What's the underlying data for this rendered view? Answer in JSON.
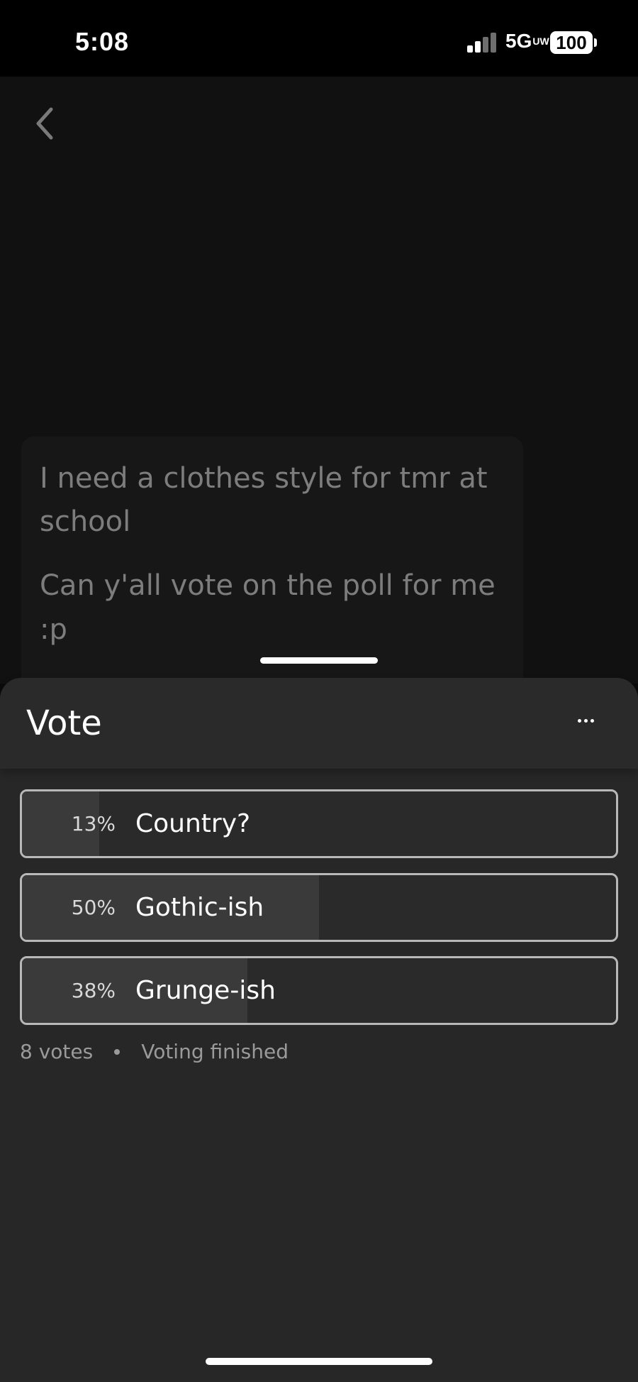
{
  "status_bar": {
    "time": "5:08",
    "network": "5G",
    "network_sub": "UW",
    "battery": "100"
  },
  "post": {
    "lines": [
      "I need a clothes style for tmr at",
      "school",
      "Can y'all vote on the poll for me",
      ":p"
    ]
  },
  "poll": {
    "title": "Vote",
    "options": [
      {
        "percent": "13%",
        "label": "Country?",
        "fraction": 0.13
      },
      {
        "percent": "50%",
        "label": "Gothic-ish",
        "fraction": 0.5
      },
      {
        "percent": "38%",
        "label": "Grunge-ish",
        "fraction": 0.38
      }
    ],
    "votes": "8 votes",
    "status": "Voting finished"
  },
  "icons": {
    "back": "chevron-left-icon",
    "more": "more-horizontal-icon"
  },
  "colors": {
    "background": "#111111",
    "sheet": "#272727",
    "option_border": "#b8b8b8",
    "option_fill": "#3a3a3a",
    "muted_text": "#9a9a9a"
  }
}
